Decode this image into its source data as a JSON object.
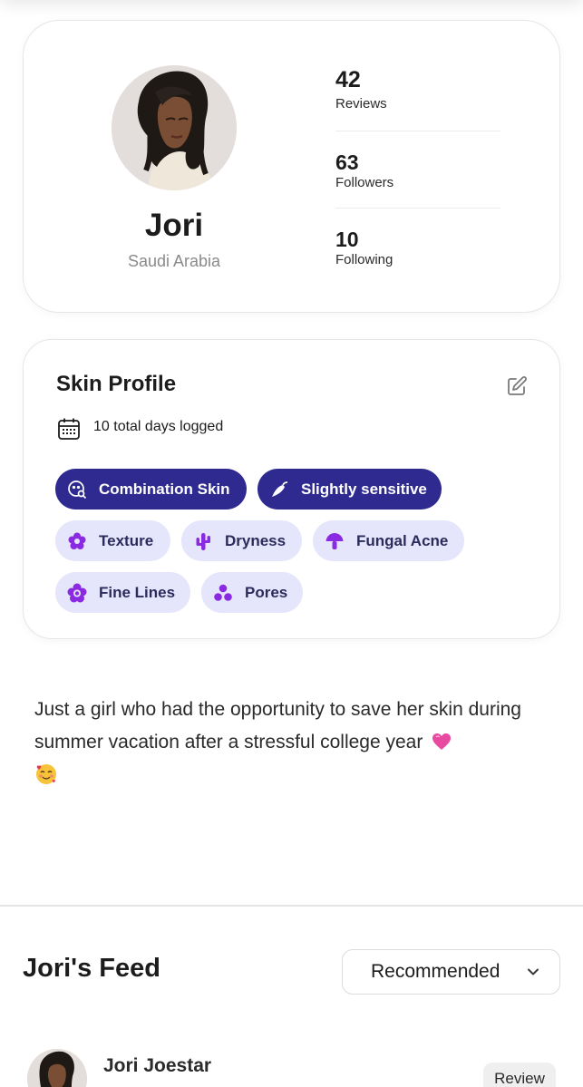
{
  "profile": {
    "name": "Jori",
    "country": "Saudi Arabia",
    "stats": [
      {
        "value": "42",
        "label": "Reviews"
      },
      {
        "value": "63",
        "label": "Followers"
      },
      {
        "value": "10",
        "label": "Following"
      }
    ]
  },
  "skin_profile": {
    "title": "Skin Profile",
    "days_logged": "10 total days logged",
    "primary_tags": [
      {
        "label": "Combination Skin",
        "icon": "face-search-icon"
      },
      {
        "label": "Slightly sensitive",
        "icon": "chili-pepper-icon"
      }
    ],
    "concern_tags": [
      {
        "label": "Texture",
        "icon": "flower-icon"
      },
      {
        "label": "Dryness",
        "icon": "cactus-icon"
      },
      {
        "label": "Fungal Acne",
        "icon": "mushroom-icon"
      },
      {
        "label": "Fine Lines",
        "icon": "rose-icon"
      },
      {
        "label": "Pores",
        "icon": "circles-icon"
      }
    ]
  },
  "bio": {
    "text": "Just a girl who had the opportunity to save her skin during summer vacation after a stressful college year"
  },
  "feed": {
    "title": "Jori's Feed",
    "sort_selected": "Recommended"
  },
  "post": {
    "author": "Jori Joestar",
    "badge": "Review"
  },
  "colors": {
    "chip_dark": "#2f2a8f",
    "chip_light": "#e5e5fb",
    "icon_purple": "#8a2be2"
  }
}
